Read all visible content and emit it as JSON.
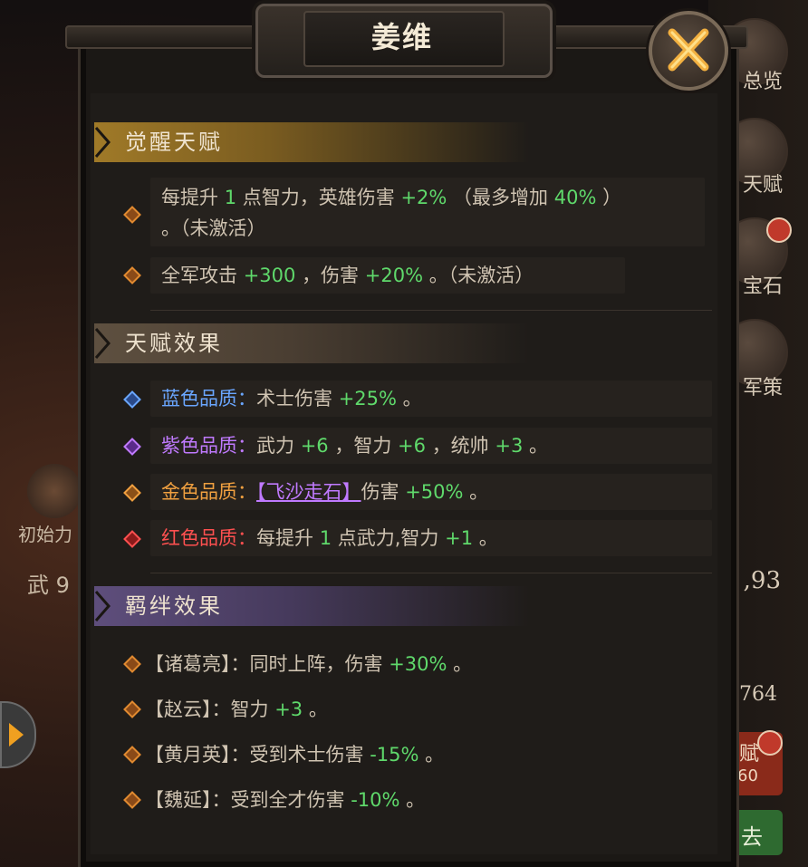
{
  "dialog": {
    "title": "姜维",
    "close_icon": "close-x-icon"
  },
  "background": {
    "right_labels": [
      "总览",
      "天赋",
      "宝石",
      "军策"
    ],
    "left_label": "初始力",
    "left_stat": "武 9",
    "right_stat": ",93",
    "right_value": "764",
    "right_btn_1": "赋",
    "right_btn_1_sub": "60",
    "right_btn_2": "去"
  },
  "sections": {
    "awaken": {
      "title": "觉醒天赋",
      "items": [
        {
          "line1_a": "每提升",
          "line1_b": "1",
          "line1_c": "点智力，英雄伤害",
          "line1_d": "+2%",
          "line1_e": "（最多增加",
          "line1_f": "40%",
          "line1_g": "）",
          "line2": "。（未激活）"
        },
        {
          "a": "全军攻击",
          "b": "+300",
          "c": "，伤害",
          "d": "+20%",
          "e": "。（未激活）"
        }
      ]
    },
    "talent": {
      "title": "天赋效果",
      "items": [
        {
          "quality": "蓝色品质：",
          "a": "术士伤害",
          "b": "+25%",
          "c": "。"
        },
        {
          "quality": "紫色品质：",
          "a": "武力",
          "b": "+6",
          "c": "，智力",
          "d": "+6",
          "e": "，统帅",
          "f": "+3",
          "g": "。"
        },
        {
          "quality": "金色品质：",
          "skill": "【飞沙走石】",
          "a": "伤害",
          "b": "+50%",
          "c": "。"
        },
        {
          "quality": "红色品质：",
          "a": "每提升",
          "b": "1",
          "c": "点武力,智力",
          "d": "+1",
          "e": "。"
        }
      ]
    },
    "bond": {
      "title": "羁绊效果",
      "items": [
        {
          "hero": "【诸葛亮】",
          "sep": "：",
          "a": "同时上阵，伤害",
          "b": "+30%",
          "c": "。"
        },
        {
          "hero": "【赵云】",
          "sep": "：",
          "a": "智力",
          "b": "+3",
          "c": "。"
        },
        {
          "hero": "【黄月英】",
          "sep": "：",
          "a": "受到术士伤害",
          "b": "-15%",
          "c": "。"
        },
        {
          "hero": "【魏延】",
          "sep": "：",
          "a": "受到全才伤害",
          "b": "-10%",
          "c": "。"
        }
      ]
    }
  },
  "colors": {
    "accent_gold": "#b8902e",
    "positive_green": "#5fd96b",
    "blue_quality": "#6aa6ff",
    "purple_quality": "#c07aff",
    "gold_quality": "#f0a040",
    "red_quality": "#ff5050",
    "bond_purple": "#6b568a"
  }
}
